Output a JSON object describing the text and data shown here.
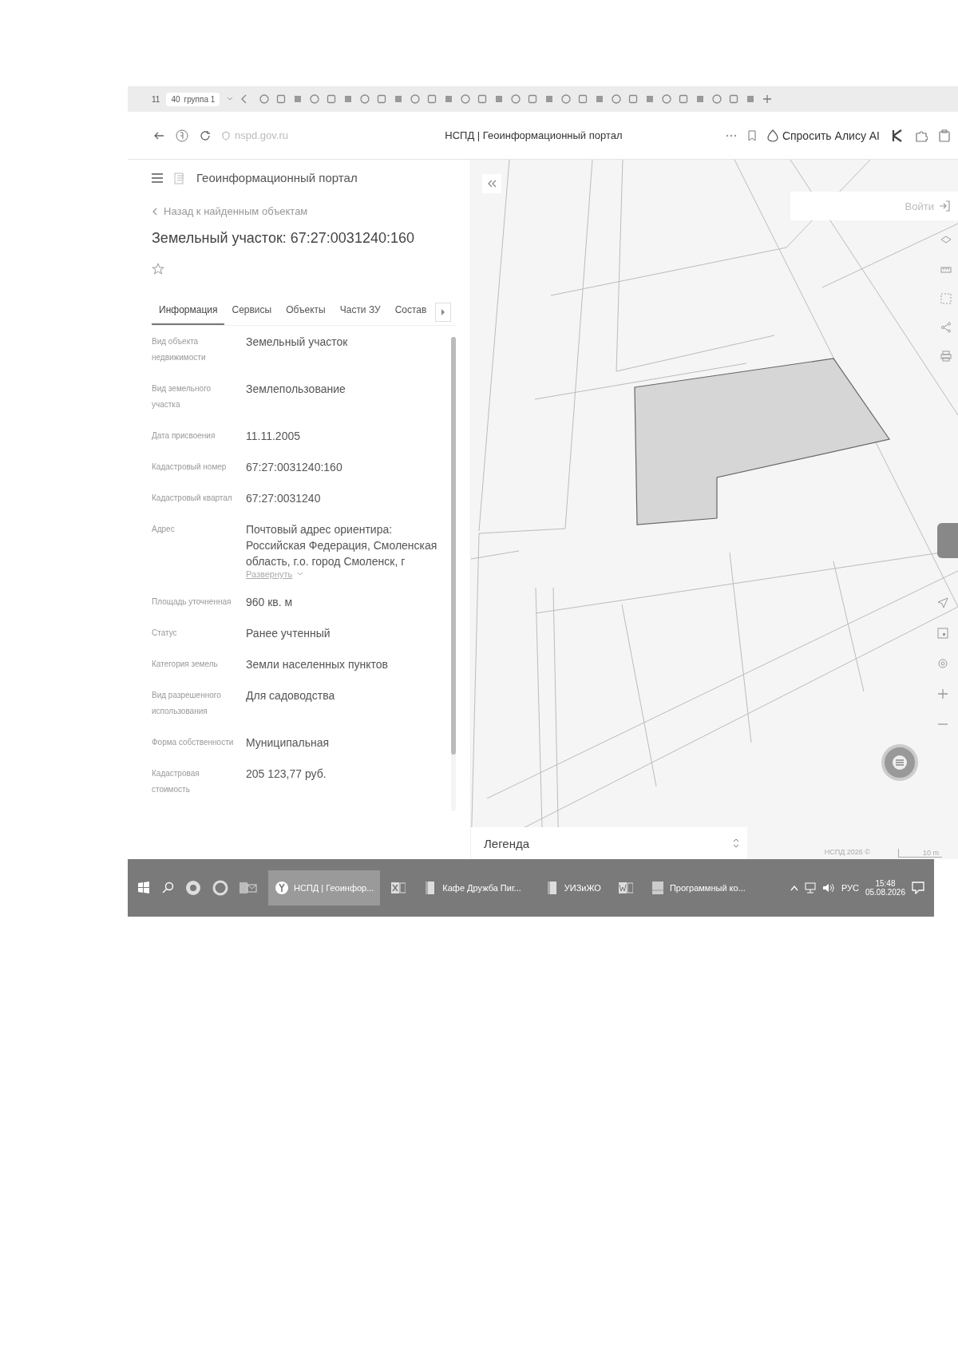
{
  "browser": {
    "tab_count": "11",
    "group": {
      "count": "40",
      "label": "группа 1"
    },
    "url": "nspd.gov.ru",
    "page_title": "НСПД | Геоинформационный портал",
    "assistant_button": "Спросить Алису AI"
  },
  "app": {
    "title": "Геоинформационный портал",
    "back_link": "Назад к найденным объектам",
    "object_title": "Земельный участок: 67:27:0031240:160",
    "favorited": false,
    "tabs": [
      {
        "label": "Информация",
        "selected": true
      },
      {
        "label": "Сервисы",
        "selected": false
      },
      {
        "label": "Объекты",
        "selected": false
      },
      {
        "label": "Части ЗУ",
        "selected": false
      },
      {
        "label": "Состав",
        "selected": false
      }
    ],
    "fields": [
      {
        "label": "Вид объекта недвижимости",
        "value": "Земельный участок"
      },
      {
        "label": "Вид земельного участка",
        "value": "Землепользование"
      },
      {
        "label": "Дата присвоения",
        "value": "11.11.2005"
      },
      {
        "label": "Кадастровый номер",
        "value": "67:27:0031240:160"
      },
      {
        "label": "Кадастровый квартал",
        "value": "67:27:0031240"
      },
      {
        "label": "Адрес",
        "value": "Почтовый адрес ориентира: Российская Федерация, Смоленская область, г.о. город Смоленск, г",
        "expand_link": "Развернуть"
      },
      {
        "label": "Площадь уточненная",
        "value": "960 кв. м"
      },
      {
        "label": "Статус",
        "value": "Ранее учтенный"
      },
      {
        "label": "Категория земель",
        "value": "Земли населенных пунктов"
      },
      {
        "label": "Вид разрешенного использования",
        "value": "Для садоводства"
      },
      {
        "label": "Форма собственности",
        "value": "Муниципальная"
      },
      {
        "label": "Кадастровая стоимость",
        "value": "205 123,77 руб."
      }
    ]
  },
  "map": {
    "login_button": "Войти",
    "legend": "Легенда",
    "attribution": "НСПД 2026 ©",
    "scale": "10 m"
  },
  "taskbar": {
    "apps": [
      {
        "label": "НСПД | Геоинфор...",
        "selected": true
      },
      {
        "label": "Кафе Дружба Пиг...",
        "selected": false
      },
      {
        "label": "УИЗиЖО",
        "selected": false
      },
      {
        "label": "Программный ко...",
        "selected": false
      }
    ],
    "language": "РУС",
    "time": "15:48",
    "date": "05.08.2026"
  }
}
